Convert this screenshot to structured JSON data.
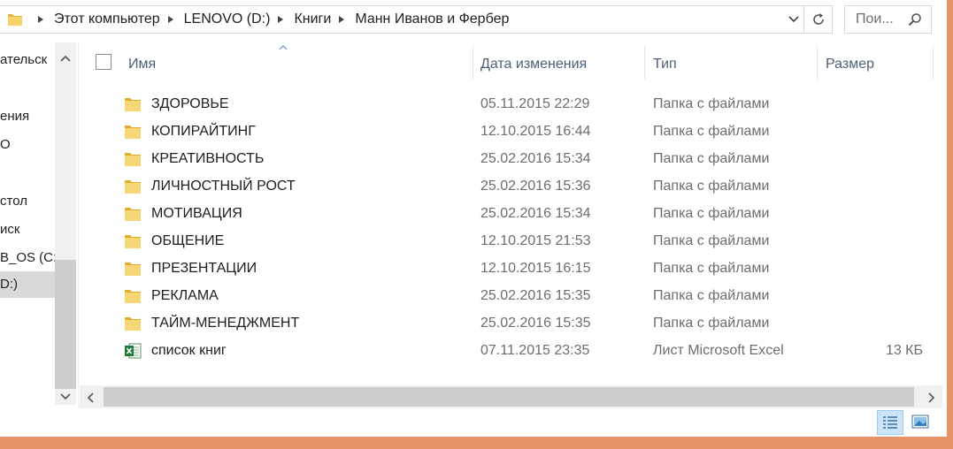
{
  "address": {
    "breadcrumbs": [
      "Этот компьютер",
      "LENOVO (D:)",
      "Книги",
      "Манн Иванов и Фербер"
    ],
    "search_placeholder": "Пои..."
  },
  "nav": {
    "items": [
      {
        "label": "ательск",
        "selected": false
      },
      {
        "label": "ения",
        "selected": false
      },
      {
        "label": "О",
        "selected": false
      },
      {
        "label": "стол",
        "selected": false
      },
      {
        "label": "иск",
        "selected": false
      },
      {
        "label": "B_OS (C:",
        "selected": false
      },
      {
        "label": "D:)",
        "selected": true
      }
    ]
  },
  "columns": {
    "name": "Имя",
    "date": "Дата изменения",
    "type": "Тип",
    "size": "Размер"
  },
  "files": [
    {
      "name": "ЗДОРОВЬЕ",
      "date": "05.11.2015 22:29",
      "type": "Папка с файлами",
      "size": "",
      "icon": "folder-icon"
    },
    {
      "name": "КОПИРАЙТИНГ",
      "date": "12.10.2015 16:44",
      "type": "Папка с файлами",
      "size": "",
      "icon": "folder-icon"
    },
    {
      "name": "КРЕАТИВНОСТЬ",
      "date": "25.02.2016 15:34",
      "type": "Папка с файлами",
      "size": "",
      "icon": "folder-icon"
    },
    {
      "name": "ЛИЧНОСТНЫЙ РОСТ",
      "date": "25.02.2016 15:36",
      "type": "Папка с файлами",
      "size": "",
      "icon": "folder-icon"
    },
    {
      "name": "МОТИВАЦИЯ",
      "date": "25.02.2016 15:34",
      "type": "Папка с файлами",
      "size": "",
      "icon": "folder-icon"
    },
    {
      "name": "ОБЩЕНИЕ",
      "date": "12.10.2015 21:53",
      "type": "Папка с файлами",
      "size": "",
      "icon": "folder-icon"
    },
    {
      "name": "ПРЕЗЕНТАЦИИ",
      "date": "12.10.2015 16:15",
      "type": "Папка с файлами",
      "size": "",
      "icon": "folder-icon"
    },
    {
      "name": "РЕКЛАМА",
      "date": "25.02.2016 15:35",
      "type": "Папка с файлами",
      "size": "",
      "icon": "folder-icon"
    },
    {
      "name": "ТАЙМ-МЕНЕДЖМЕНТ",
      "date": "25.02.2016 15:35",
      "type": "Папка с файлами",
      "size": "",
      "icon": "folder-icon"
    },
    {
      "name": "список книг",
      "date": "07.11.2015 23:35",
      "type": "Лист Microsoft Excel",
      "size": "13 КБ",
      "icon": "excel-file-icon"
    }
  ],
  "colors": {
    "desktop_background": "#e8926a",
    "header_text": "#4c607a",
    "secondary_text": "#6d6d6d",
    "selection": "#cce4f7",
    "folder_yellow": "#f3c94b"
  }
}
